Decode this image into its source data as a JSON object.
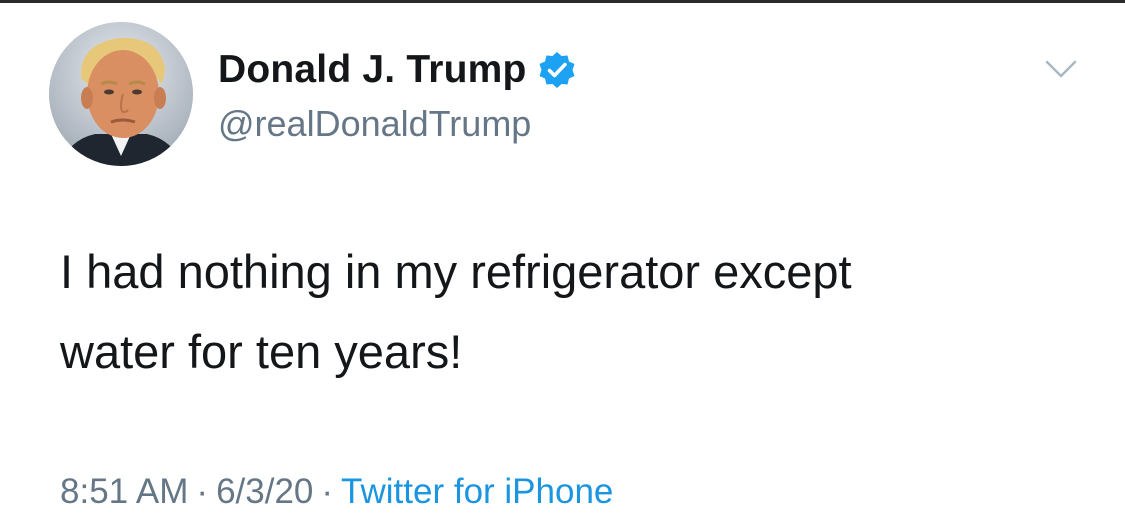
{
  "tweet": {
    "author": {
      "display_name": "Donald J. Trump",
      "handle": "@realDonaldTrump",
      "verified": true,
      "avatar_icon": "profile-photo"
    },
    "text_line_1": "I had nothing in my refrigerator except",
    "text_line_2": "water for ten years!",
    "time": "8:51 AM",
    "date": "6/3/20",
    "separator": "·",
    "source": "Twitter for iPhone",
    "menu_icon": "chevron-down-icon"
  },
  "colors": {
    "text": "#14171a",
    "secondary": "#657786",
    "link": "#1b95e0",
    "verified": "#1da1f2",
    "background": "#ffffff"
  }
}
